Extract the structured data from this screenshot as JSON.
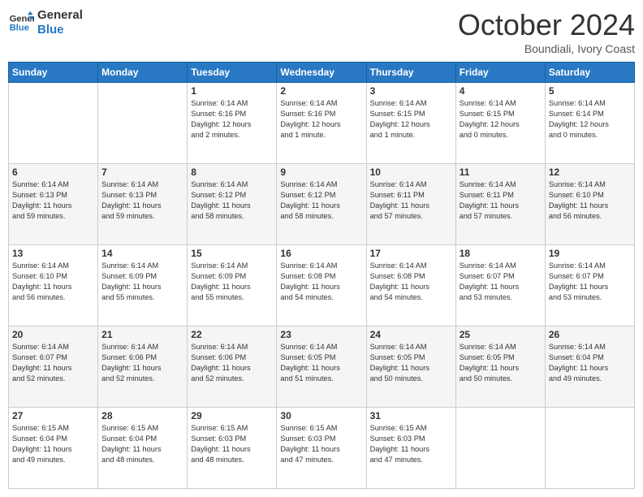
{
  "header": {
    "logo_line1": "General",
    "logo_line2": "Blue",
    "month_year": "October 2024",
    "location": "Boundiali, Ivory Coast"
  },
  "weekdays": [
    "Sunday",
    "Monday",
    "Tuesday",
    "Wednesday",
    "Thursday",
    "Friday",
    "Saturday"
  ],
  "weeks": [
    [
      {
        "day": "",
        "info": ""
      },
      {
        "day": "",
        "info": ""
      },
      {
        "day": "1",
        "info": "Sunrise: 6:14 AM\nSunset: 6:16 PM\nDaylight: 12 hours\nand 2 minutes."
      },
      {
        "day": "2",
        "info": "Sunrise: 6:14 AM\nSunset: 6:16 PM\nDaylight: 12 hours\nand 1 minute."
      },
      {
        "day": "3",
        "info": "Sunrise: 6:14 AM\nSunset: 6:15 PM\nDaylight: 12 hours\nand 1 minute."
      },
      {
        "day": "4",
        "info": "Sunrise: 6:14 AM\nSunset: 6:15 PM\nDaylight: 12 hours\nand 0 minutes."
      },
      {
        "day": "5",
        "info": "Sunrise: 6:14 AM\nSunset: 6:14 PM\nDaylight: 12 hours\nand 0 minutes."
      }
    ],
    [
      {
        "day": "6",
        "info": "Sunrise: 6:14 AM\nSunset: 6:13 PM\nDaylight: 11 hours\nand 59 minutes."
      },
      {
        "day": "7",
        "info": "Sunrise: 6:14 AM\nSunset: 6:13 PM\nDaylight: 11 hours\nand 59 minutes."
      },
      {
        "day": "8",
        "info": "Sunrise: 6:14 AM\nSunset: 6:12 PM\nDaylight: 11 hours\nand 58 minutes."
      },
      {
        "day": "9",
        "info": "Sunrise: 6:14 AM\nSunset: 6:12 PM\nDaylight: 11 hours\nand 58 minutes."
      },
      {
        "day": "10",
        "info": "Sunrise: 6:14 AM\nSunset: 6:11 PM\nDaylight: 11 hours\nand 57 minutes."
      },
      {
        "day": "11",
        "info": "Sunrise: 6:14 AM\nSunset: 6:11 PM\nDaylight: 11 hours\nand 57 minutes."
      },
      {
        "day": "12",
        "info": "Sunrise: 6:14 AM\nSunset: 6:10 PM\nDaylight: 11 hours\nand 56 minutes."
      }
    ],
    [
      {
        "day": "13",
        "info": "Sunrise: 6:14 AM\nSunset: 6:10 PM\nDaylight: 11 hours\nand 56 minutes."
      },
      {
        "day": "14",
        "info": "Sunrise: 6:14 AM\nSunset: 6:09 PM\nDaylight: 11 hours\nand 55 minutes."
      },
      {
        "day": "15",
        "info": "Sunrise: 6:14 AM\nSunset: 6:09 PM\nDaylight: 11 hours\nand 55 minutes."
      },
      {
        "day": "16",
        "info": "Sunrise: 6:14 AM\nSunset: 6:08 PM\nDaylight: 11 hours\nand 54 minutes."
      },
      {
        "day": "17",
        "info": "Sunrise: 6:14 AM\nSunset: 6:08 PM\nDaylight: 11 hours\nand 54 minutes."
      },
      {
        "day": "18",
        "info": "Sunrise: 6:14 AM\nSunset: 6:07 PM\nDaylight: 11 hours\nand 53 minutes."
      },
      {
        "day": "19",
        "info": "Sunrise: 6:14 AM\nSunset: 6:07 PM\nDaylight: 11 hours\nand 53 minutes."
      }
    ],
    [
      {
        "day": "20",
        "info": "Sunrise: 6:14 AM\nSunset: 6:07 PM\nDaylight: 11 hours\nand 52 minutes."
      },
      {
        "day": "21",
        "info": "Sunrise: 6:14 AM\nSunset: 6:06 PM\nDaylight: 11 hours\nand 52 minutes."
      },
      {
        "day": "22",
        "info": "Sunrise: 6:14 AM\nSunset: 6:06 PM\nDaylight: 11 hours\nand 52 minutes."
      },
      {
        "day": "23",
        "info": "Sunrise: 6:14 AM\nSunset: 6:05 PM\nDaylight: 11 hours\nand 51 minutes."
      },
      {
        "day": "24",
        "info": "Sunrise: 6:14 AM\nSunset: 6:05 PM\nDaylight: 11 hours\nand 50 minutes."
      },
      {
        "day": "25",
        "info": "Sunrise: 6:14 AM\nSunset: 6:05 PM\nDaylight: 11 hours\nand 50 minutes."
      },
      {
        "day": "26",
        "info": "Sunrise: 6:14 AM\nSunset: 6:04 PM\nDaylight: 11 hours\nand 49 minutes."
      }
    ],
    [
      {
        "day": "27",
        "info": "Sunrise: 6:15 AM\nSunset: 6:04 PM\nDaylight: 11 hours\nand 49 minutes."
      },
      {
        "day": "28",
        "info": "Sunrise: 6:15 AM\nSunset: 6:04 PM\nDaylight: 11 hours\nand 48 minutes."
      },
      {
        "day": "29",
        "info": "Sunrise: 6:15 AM\nSunset: 6:03 PM\nDaylight: 11 hours\nand 48 minutes."
      },
      {
        "day": "30",
        "info": "Sunrise: 6:15 AM\nSunset: 6:03 PM\nDaylight: 11 hours\nand 47 minutes."
      },
      {
        "day": "31",
        "info": "Sunrise: 6:15 AM\nSunset: 6:03 PM\nDaylight: 11 hours\nand 47 minutes."
      },
      {
        "day": "",
        "info": ""
      },
      {
        "day": "",
        "info": ""
      }
    ]
  ]
}
